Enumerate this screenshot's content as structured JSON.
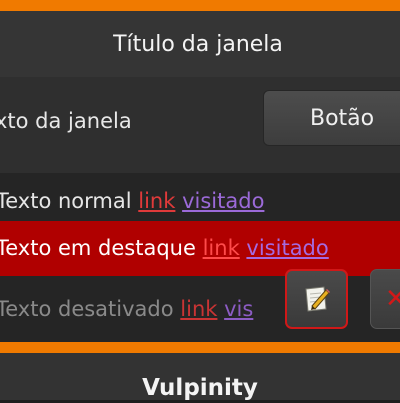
{
  "window": {
    "title": "Título da janela",
    "label": "xto da janela",
    "button_label": "Botão"
  },
  "text_rows": {
    "normal": {
      "text": "Texto normal",
      "link": "link",
      "visited": "visitado"
    },
    "highlight": {
      "text": "Texto em destaque",
      "link": "link",
      "visited": "visitado"
    },
    "disabled": {
      "text": "Texto desativado",
      "link": "link",
      "visited": "vis"
    }
  },
  "icons": {
    "edit": "pencil-paper-icon",
    "close": "close-icon"
  },
  "next_panel": {
    "title": "Vulpinity"
  },
  "colors": {
    "accent": "#f07a00",
    "highlight": "#b00000",
    "link": "#e03a3a",
    "visited": "#9b6ad8"
  }
}
